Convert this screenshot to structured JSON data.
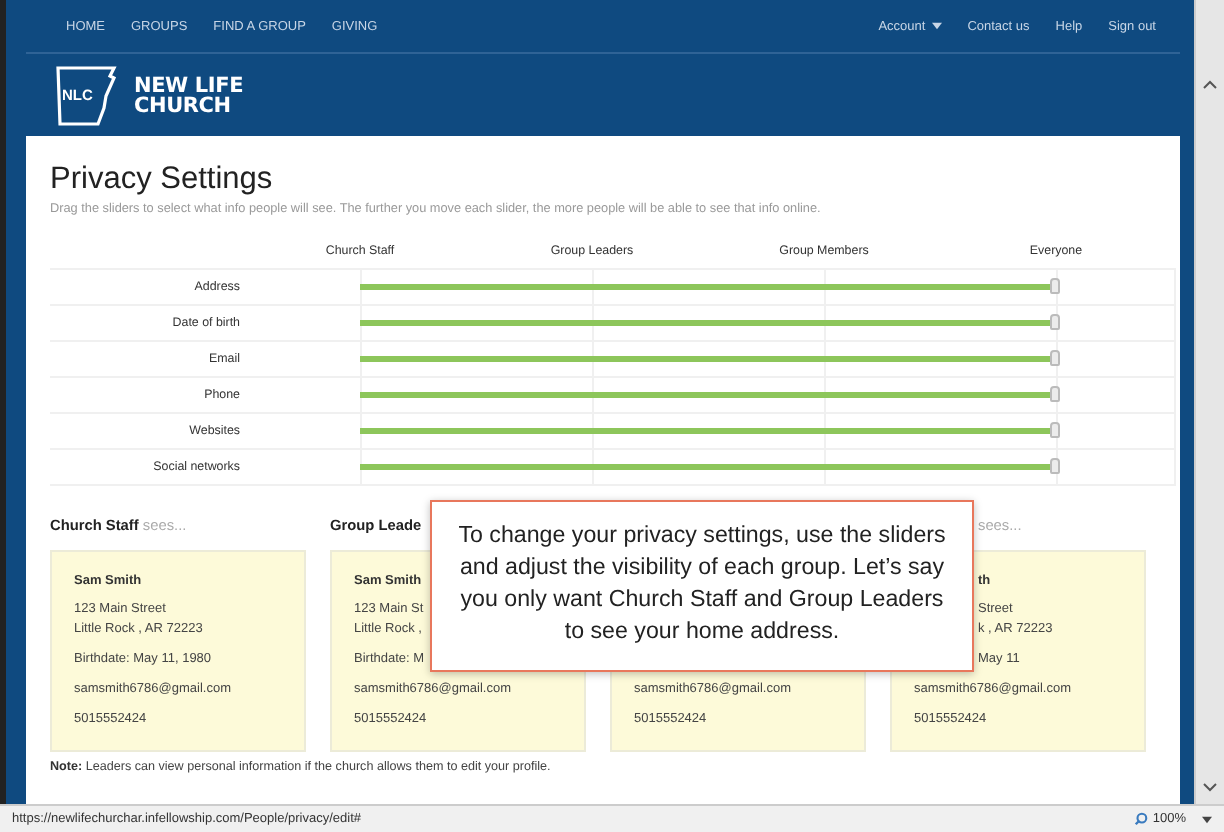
{
  "nav": {
    "left": [
      {
        "label": "HOME"
      },
      {
        "label": "GROUPS"
      },
      {
        "label": "FIND A GROUP"
      },
      {
        "label": "GIVING"
      }
    ],
    "right": [
      {
        "label": "Account",
        "dropdown": true
      },
      {
        "label": "Contact us",
        "dropdown": false
      },
      {
        "label": "Help",
        "dropdown": false
      },
      {
        "label": "Sign out",
        "dropdown": false
      }
    ]
  },
  "logo": {
    "mark": "NLC",
    "line_1": "NEW LIFE",
    "line_2": "CHURCH"
  },
  "page": {
    "title": "Privacy Settings",
    "subtitle": "Drag the sliders to select what info people will see. The further you move each slider, the more people will be able to see that info online."
  },
  "privacy_table": {
    "columns": [
      "Church Staff",
      "Group Leaders",
      "Group Members",
      "Everyone"
    ],
    "rows": [
      {
        "label": "Address",
        "level": 1
      },
      {
        "label": "Date of birth",
        "level": 1
      },
      {
        "label": "Email",
        "level": 1
      },
      {
        "label": "Phone",
        "level": 1
      },
      {
        "label": "Websites",
        "level": 1
      },
      {
        "label": "Social networks",
        "level": 1
      }
    ]
  },
  "cards": [
    {
      "heading": "Church Staff",
      "suffix": "sees...",
      "lines": [
        {
          "kind": "name",
          "text": "Sam Smith"
        },
        {
          "kind": "address",
          "text": "123 Main Street"
        },
        {
          "kind": "address2",
          "text": "Little Rock , AR  72223"
        },
        {
          "kind": "birthdate",
          "text": "Birthdate: May 11, 1980"
        },
        {
          "kind": "email",
          "text": "samsmith6786@gmail.com"
        },
        {
          "kind": "phone",
          "text": "5015552424"
        }
      ]
    },
    {
      "heading": "Group Leade",
      "lines": [
        {
          "kind": "name",
          "text": "Sam Smith"
        },
        {
          "kind": "address",
          "text": "123 Main St"
        },
        {
          "kind": "address2",
          "text": "Little Rock ,"
        },
        {
          "kind": "birthdate",
          "text": "Birthdate: M"
        },
        {
          "kind": "email",
          "text": "samsmith6786@gmail.com"
        },
        {
          "kind": "phone",
          "text": "5015552424"
        }
      ]
    },
    {
      "lines": [
        {
          "kind": "email",
          "text": "samsmith6786@gmail.com"
        },
        {
          "kind": "phone",
          "text": "5015552424"
        }
      ]
    },
    {
      "suffix": "sees...",
      "lines": [
        {
          "kind": "name",
          "text": "th"
        },
        {
          "kind": "address",
          "text": "Street"
        },
        {
          "kind": "address2",
          "text": "k , AR  72223"
        },
        {
          "kind": "birthdate",
          "text": "May 11"
        },
        {
          "kind": "email",
          "text": "samsmith6786@gmail.com"
        },
        {
          "kind": "phone",
          "text": "5015552424"
        }
      ]
    }
  ],
  "note": {
    "label": "Note:",
    "text": "Leaders can view personal information if the church allows them to edit your profile."
  },
  "callout": "To change your privacy settings, use the sliders and adjust the visibility of each group.  Let’s say you only want Church Staff and Group Leaders to see your home address.",
  "status_bar": {
    "url": "https://newlifechurchar.infellowship.com/People/privacy/edit#",
    "zoom": "100%"
  }
}
